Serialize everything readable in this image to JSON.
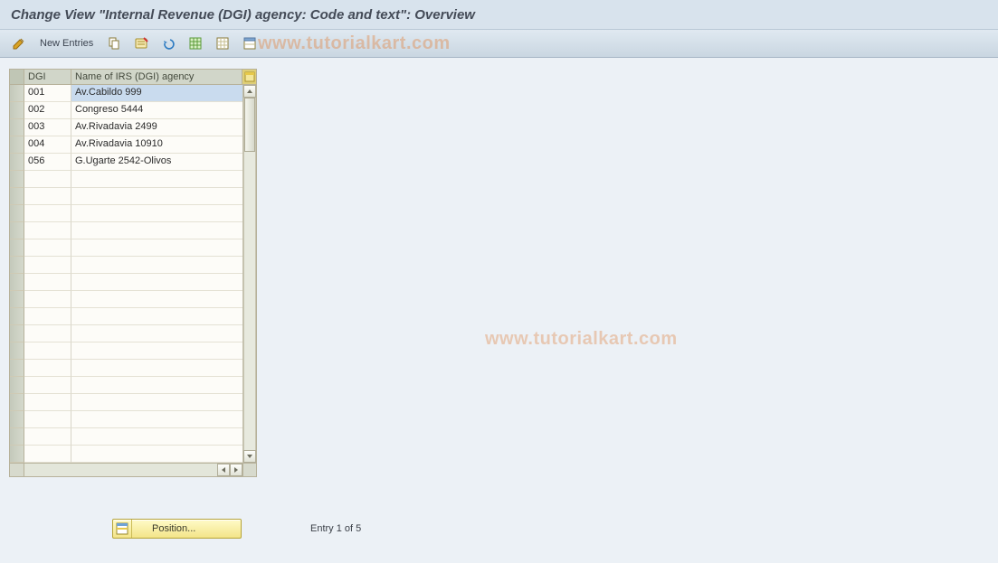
{
  "title": "Change View \"Internal Revenue (DGI) agency: Code and text\": Overview",
  "toolbar": {
    "new_entries_label": "New Entries"
  },
  "watermark": "www.tutorialkart.com",
  "table": {
    "headers": {
      "dgi": "DGI",
      "name": "Name of IRS (DGI) agency"
    },
    "rows": [
      {
        "dgi": "001",
        "name": "Av.Cabildo 999"
      },
      {
        "dgi": "002",
        "name": "Congreso 5444"
      },
      {
        "dgi": "003",
        "name": "Av.Rivadavia 2499"
      },
      {
        "dgi": "004",
        "name": "Av.Rivadavia 10910"
      },
      {
        "dgi": "056",
        "name": "G.Ugarte 2542-Olivos"
      }
    ],
    "visible_row_count": 22,
    "selected_cell_row": 0
  },
  "footer": {
    "position_label": "Position...",
    "entry_status": "Entry 1 of 5"
  }
}
